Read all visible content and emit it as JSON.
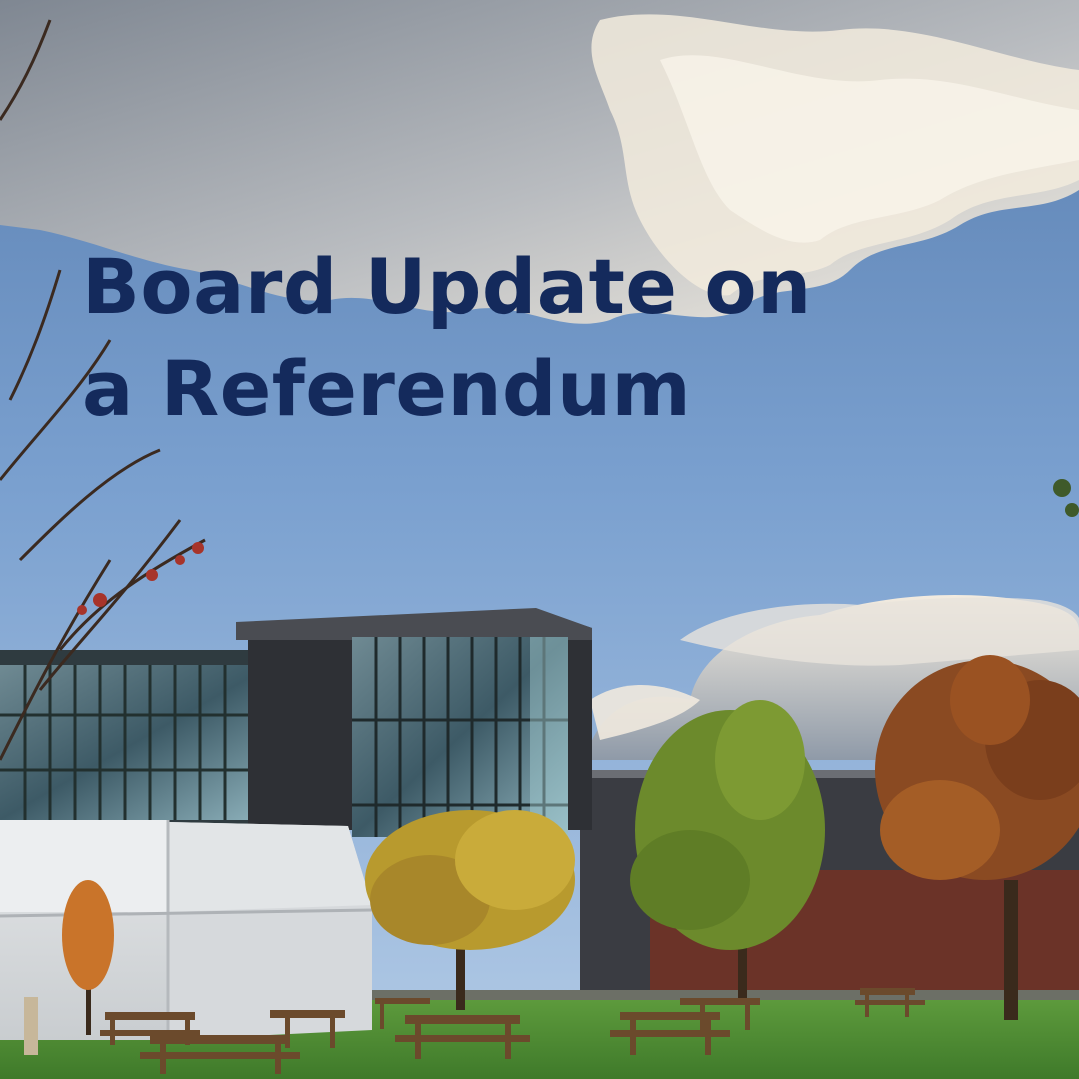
{
  "post": {
    "title_line1": "Board Update on",
    "title_line2": "a Referendum"
  },
  "colors": {
    "title": "#142a5c",
    "sky_top": "#5f86b8",
    "sky_bottom": "#a9c6e6",
    "grass": "#4f8a34"
  },
  "scene": {
    "description_icons": [
      "cloud",
      "glass-building",
      "white-tent",
      "autumn-tree",
      "picnic-table"
    ]
  }
}
